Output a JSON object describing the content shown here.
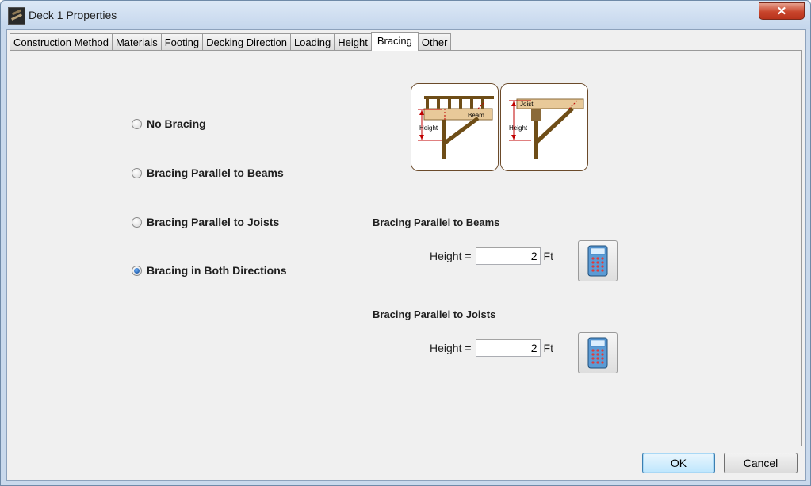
{
  "window": {
    "title": "Deck 1 Properties",
    "close_label": "✕"
  },
  "tabs": [
    {
      "label": "Construction Method"
    },
    {
      "label": "Materials"
    },
    {
      "label": "Footing"
    },
    {
      "label": "Decking Direction"
    },
    {
      "label": "Loading"
    },
    {
      "label": "Height"
    },
    {
      "label": "Bracing",
      "active": true
    },
    {
      "label": "Other"
    }
  ],
  "bracing_options": [
    {
      "label": "No Bracing",
      "checked": false
    },
    {
      "label": "Bracing Parallel to Beams",
      "checked": false
    },
    {
      "label": "Bracing Parallel to Joists",
      "checked": false
    },
    {
      "label": "Bracing in Both Directions",
      "checked": true
    }
  ],
  "diagrams": {
    "beam": {
      "height_label": "Height",
      "member_label": "Beam"
    },
    "joist": {
      "height_label": "Height",
      "member_label": "Joist"
    }
  },
  "beams_section": {
    "title": "Bracing Parallel to Beams",
    "height_label": "Height =",
    "value": "2",
    "unit": "Ft"
  },
  "joists_section": {
    "title": "Bracing Parallel to Joists",
    "height_label": "Height =",
    "value": "2",
    "unit": "Ft"
  },
  "buttons": {
    "ok": "OK",
    "cancel": "Cancel"
  }
}
